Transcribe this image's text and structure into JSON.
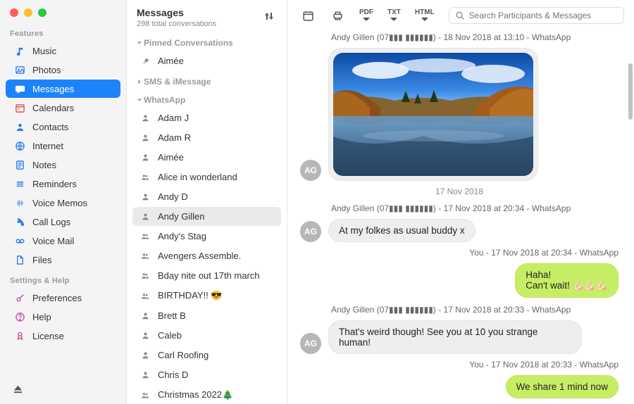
{
  "left": {
    "features_header": "Features",
    "settings_header": "Settings & Help",
    "features": [
      {
        "label": "Music",
        "icon": "music"
      },
      {
        "label": "Photos",
        "icon": "photos"
      },
      {
        "label": "Messages",
        "icon": "messages",
        "selected": true
      },
      {
        "label": "Calendars",
        "icon": "calendar"
      },
      {
        "label": "Contacts",
        "icon": "contacts"
      },
      {
        "label": "Internet",
        "icon": "internet"
      },
      {
        "label": "Notes",
        "icon": "notes"
      },
      {
        "label": "Reminders",
        "icon": "reminders"
      },
      {
        "label": "Voice Memos",
        "icon": "voicememos"
      },
      {
        "label": "Call Logs",
        "icon": "calllogs"
      },
      {
        "label": "Voice Mail",
        "icon": "voicemail"
      },
      {
        "label": "Files",
        "icon": "files"
      }
    ],
    "settings": [
      {
        "label": "Preferences",
        "icon": "prefs"
      },
      {
        "label": "Help",
        "icon": "help"
      },
      {
        "label": "License",
        "icon": "license"
      }
    ]
  },
  "mid": {
    "title": "Messages",
    "subtitle": "298 total conversations",
    "groups": {
      "pinned_label": "Pinned Conversations",
      "sms_label": "SMS & iMessage",
      "whatsapp_label": "WhatsApp",
      "pinned": [
        {
          "label": "Aimée",
          "icon": "pin"
        }
      ],
      "whatsapp": [
        {
          "label": "Adam J",
          "icon": "person"
        },
        {
          "label": "Adam R",
          "icon": "person"
        },
        {
          "label": "Aimée",
          "icon": "person"
        },
        {
          "label": "Alice in wonderland",
          "icon": "group"
        },
        {
          "label": "Andy D",
          "icon": "person"
        },
        {
          "label": "Andy Gillen",
          "icon": "person",
          "selected": true
        },
        {
          "label": "Andy's Stag",
          "icon": "group"
        },
        {
          "label": "Avengers Assemble.",
          "icon": "group"
        },
        {
          "label": "Bday nite out 17th march",
          "icon": "group"
        },
        {
          "label": "BIRTHDAY!! 😎",
          "icon": "group"
        },
        {
          "label": "Brett B",
          "icon": "person"
        },
        {
          "label": "Caleb",
          "icon": "person"
        },
        {
          "label": "Carl Roofing",
          "icon": "person"
        },
        {
          "label": "Chris D",
          "icon": "person"
        },
        {
          "label": "Christmas 2022🎄",
          "icon": "group"
        }
      ]
    }
  },
  "toolbar": {
    "export_pdf": "PDF",
    "export_txt": "TXT",
    "export_html": "HTML",
    "search_placeholder": "Search Participants & Messages"
  },
  "chat": {
    "avatar_initials": "AG",
    "m1_meta": "Andy Gillen (07▮▮▮ ▮▮▮▮▮▮) - 18 Nov 2018 at 13:10 - WhatsApp",
    "date_separator": "17 Nov 2018",
    "m2_meta": "Andy Gillen (07▮▮▮ ▮▮▮▮▮▮) - 17 Nov 2018 at 20:34 - WhatsApp",
    "m2_text": "At my folkes as usual buddy x",
    "m3_meta": "You - 17 Nov 2018 at 20:34 - WhatsApp",
    "m3_line1": "Haha!",
    "m3_line2": "Can't wait! 💪🏻💪🏻💪🏻",
    "m4_meta": "Andy Gillen (07▮▮▮ ▮▮▮▮▮▮) - 17 Nov 2018 at 20:33 - WhatsApp",
    "m4_text": "That's weird though! See you at 10 you strange human!",
    "m5_meta": "You - 17 Nov 2018 at 20:33 - WhatsApp",
    "m5_text": "We share 1 mind now"
  }
}
